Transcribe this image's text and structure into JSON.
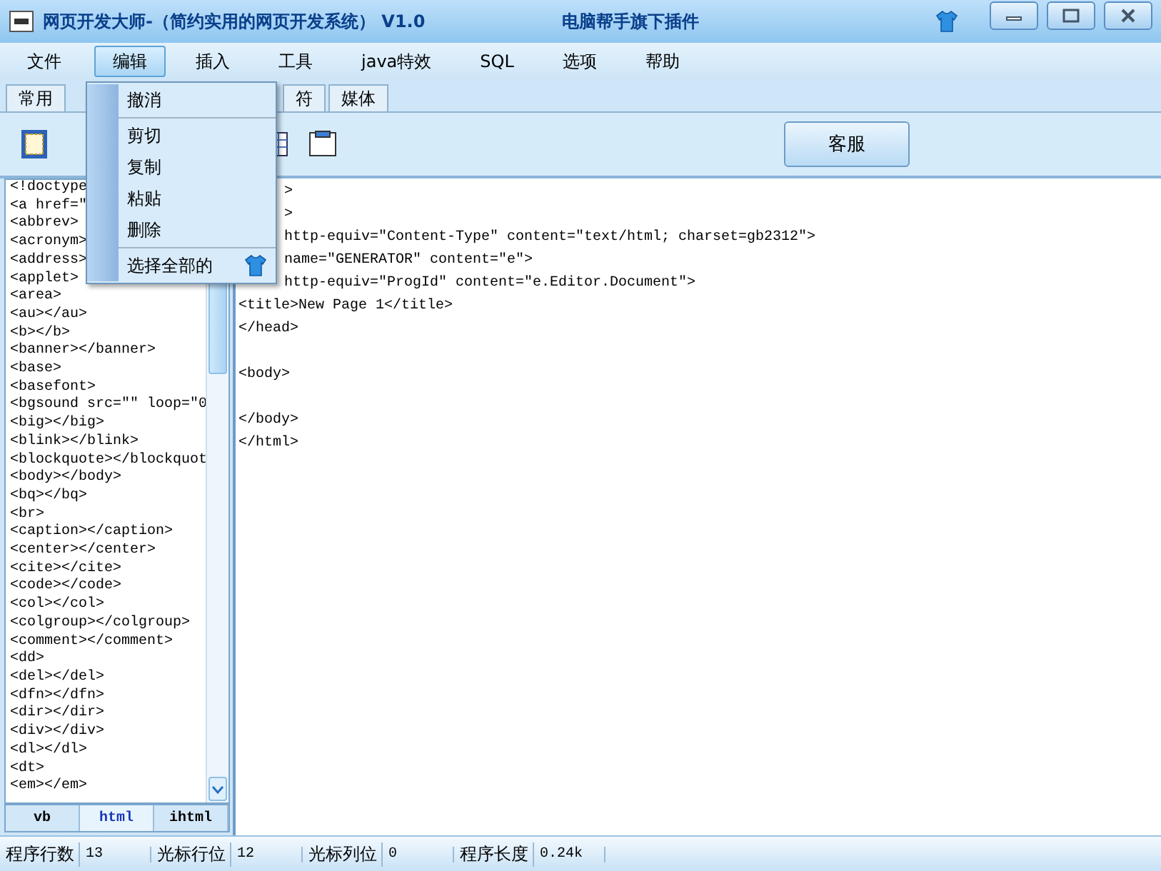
{
  "window": {
    "title": "网页开发大师-（简约实用的网页开发系统） V1.0",
    "subtitle": "电脑帮手旗下插件"
  },
  "menu_bar": [
    {
      "label": "文件",
      "selected": false
    },
    {
      "label": "编辑",
      "selected": true
    },
    {
      "label": "插入",
      "selected": false
    },
    {
      "label": "工具",
      "selected": false
    },
    {
      "label": "java特效",
      "selected": false
    },
    {
      "label": "SQL",
      "selected": false
    },
    {
      "label": "选项",
      "selected": false
    },
    {
      "label": "帮助",
      "selected": false
    }
  ],
  "edit_menu": [
    {
      "kind": "item",
      "label": "撤消"
    },
    {
      "kind": "separator"
    },
    {
      "kind": "item",
      "label": "剪切"
    },
    {
      "kind": "item",
      "label": "复制"
    },
    {
      "kind": "item",
      "label": "粘贴"
    },
    {
      "kind": "item",
      "label": "删除"
    },
    {
      "kind": "separator"
    },
    {
      "kind": "item_icon",
      "label": "选择全部的"
    }
  ],
  "toolbar_tabs": [
    {
      "label": "常用",
      "selected": false
    },
    {
      "label": "符",
      "selected": false
    },
    {
      "label": "媒体",
      "selected": false
    }
  ],
  "toolbar": {
    "service_button": "客服"
  },
  "tag_list": [
    "<!doctype",
    "<a href=\"",
    "<abbrev>",
    "<acronym>",
    "<address>",
    "<applet>",
    "<area>",
    "<au></au>",
    "<b></b>",
    "<banner></banner>",
    "<base>",
    "<basefont>",
    "<bgsound src=\"\" loop=\"0",
    "<big></big>",
    "<blink></blink>",
    "<blockquote></blockquot",
    "<body></body>",
    "<bq></bq>",
    "<br>",
    "<caption></caption>",
    "<center></center>",
    "<cite></cite>",
    "<code></code>",
    "<col></col>",
    "<colgroup></colgroup>",
    "<comment></comment>",
    "<dd>",
    "<del></del>",
    "<dfn></dfn>",
    "<dir></dir>",
    "<div></div>",
    "<dl></dl>",
    "<dt>",
    "<em></em>"
  ],
  "list_tabs": [
    {
      "label": "vb",
      "selected": false
    },
    {
      "label": "html",
      "selected": true
    },
    {
      "label": "ihtml",
      "selected": false
    }
  ],
  "editor_lines": [
    {
      "kind": "partial",
      "text": ">"
    },
    {
      "kind": "partial",
      "text": ">"
    },
    {
      "kind": "partial",
      "text": "http-equiv=\"Content-Type\" content=\"text/html; charset=gb2312\">"
    },
    {
      "kind": "partial",
      "text": "name=\"GENERATOR\" content=\"e\">"
    },
    {
      "kind": "partial",
      "text": "http-equiv=\"ProgId\" content=\"e.Editor.Document\">"
    },
    {
      "kind": "full",
      "text": "<title>New Page 1</title>"
    },
    {
      "kind": "full",
      "text": "</head>"
    },
    {
      "kind": "blank"
    },
    {
      "kind": "full",
      "text": "<body>"
    },
    {
      "kind": "blank"
    },
    {
      "kind": "full",
      "text": "</body>"
    },
    {
      "kind": "full",
      "text": "</html>"
    }
  ],
  "status_bar": [
    {
      "label": "程序行数",
      "value": "13"
    },
    {
      "label": "光标行位",
      "value": "12"
    },
    {
      "label": "光标列位",
      "value": "0"
    },
    {
      "label": "程序长度",
      "value": "0.24k"
    }
  ]
}
